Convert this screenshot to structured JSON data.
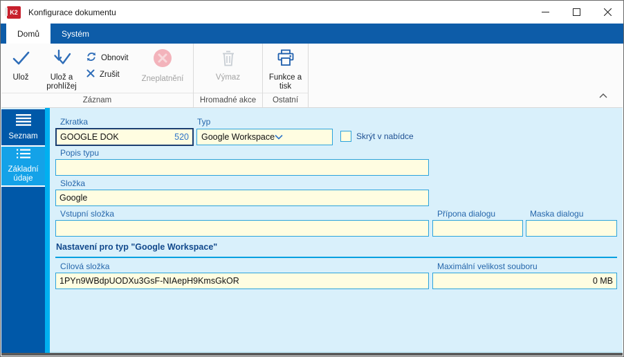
{
  "window": {
    "title": "Konfigurace dokumentu",
    "logo_text": "K2",
    "controls": {
      "minimize": "minimize",
      "maximize": "maximize",
      "close": "close"
    }
  },
  "ribbon": {
    "tabs": {
      "domu": "Domů",
      "system": "Systém"
    },
    "buttons": {
      "uloz": "Ulož",
      "uloz_a_prohlizej": "Ulož a prohlížej",
      "obnovit": "Obnovit",
      "zrusit": "Zrušit",
      "zneplatneni": "Zneplatnění",
      "vymaz": "Výmaz",
      "funkce_a_tisk": "Funkce a tisk"
    },
    "groups": {
      "zaznam": "Záznam",
      "hromadne_akce": "Hromadné akce",
      "ostatni": "Ostatní"
    }
  },
  "sidebar": {
    "items": {
      "seznam": "Seznam",
      "zakladni_udaje": "Základní údaje"
    }
  },
  "form": {
    "zkratka": {
      "label": "Zkratka",
      "value": "GOOGLE DOK",
      "number": "520"
    },
    "typ": {
      "label": "Typ",
      "value": "Google Workspace"
    },
    "skryt_v_nabidce": {
      "label": "Skrýt v nabídce",
      "checked": false
    },
    "popis_typu": {
      "label": "Popis typu",
      "value": ""
    },
    "slozka": {
      "label": "Složka",
      "value": "Google"
    },
    "vstupni_slozka": {
      "label": "Vstupní složka",
      "value": ""
    },
    "pripona_dialogu": {
      "label": "Přípona dialogu",
      "value": ""
    },
    "maska_dialogu": {
      "label": "Maska dialogu",
      "value": ""
    },
    "section_title": "Nastavení pro typ \"Google Workspace\"",
    "cilova_slozka": {
      "label": "Cílová složka",
      "value": "1PYn9WBdpUODXu3GsF-NIAepH9KmsGkOR"
    },
    "maximalni_velikost": {
      "label": "Maximální velikost souboru",
      "value": "0 MB"
    }
  },
  "colors": {
    "ribbon_blue": "#0d5ca8",
    "sidebar_blue": "#0058a8",
    "sidebar_active": "#14a2e8",
    "accent_cyan": "#00b0f0",
    "content_bg": "#d9f0fb",
    "field_bg": "#fffde1",
    "field_border": "#2ba3dc",
    "label_blue": "#2566ab",
    "focus_border": "#1b3e70",
    "number_blue": "#2e74c8",
    "section_line": "#00a0e0",
    "logo_red": "#c8202d",
    "disabled_pink": "#f3b3bb"
  }
}
